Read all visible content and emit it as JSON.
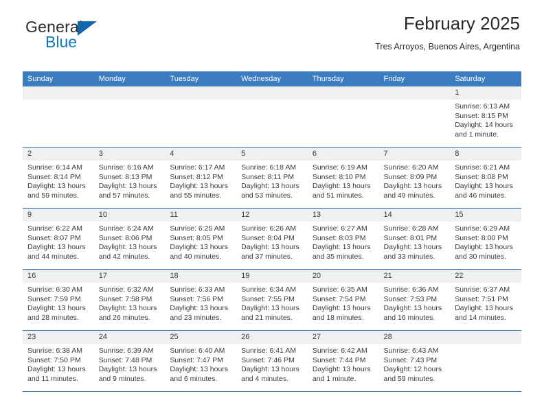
{
  "brand": {
    "line1": "General",
    "line2": "Blue",
    "triangle_icon": "blue-triangle-logo-mark",
    "color_dark": "#2b2b2b",
    "color_blue": "#1278bd"
  },
  "header": {
    "title": "February 2025",
    "subtitle": "Tres Arroyos, Buenos Aires, Argentina"
  },
  "theme": {
    "header_row_bg": "#3b7dc0",
    "daynum_band_bg": "#f0f0f0",
    "row_divider": "#3b7dc0",
    "text": "#3a3a3a"
  },
  "weekday_headers": [
    "Sunday",
    "Monday",
    "Tuesday",
    "Wednesday",
    "Thursday",
    "Friday",
    "Saturday"
  ],
  "weeks": [
    [
      {
        "day": "",
        "empty": true
      },
      {
        "day": "",
        "empty": true
      },
      {
        "day": "",
        "empty": true
      },
      {
        "day": "",
        "empty": true
      },
      {
        "day": "",
        "empty": true
      },
      {
        "day": "",
        "empty": true
      },
      {
        "day": "1",
        "sunrise": "Sunrise: 6:13 AM",
        "sunset": "Sunset: 8:15 PM",
        "daylight1": "Daylight: 14 hours",
        "daylight2": "and 1 minute."
      }
    ],
    [
      {
        "day": "2",
        "sunrise": "Sunrise: 6:14 AM",
        "sunset": "Sunset: 8:14 PM",
        "daylight1": "Daylight: 13 hours",
        "daylight2": "and 59 minutes."
      },
      {
        "day": "3",
        "sunrise": "Sunrise: 6:16 AM",
        "sunset": "Sunset: 8:13 PM",
        "daylight1": "Daylight: 13 hours",
        "daylight2": "and 57 minutes."
      },
      {
        "day": "4",
        "sunrise": "Sunrise: 6:17 AM",
        "sunset": "Sunset: 8:12 PM",
        "daylight1": "Daylight: 13 hours",
        "daylight2": "and 55 minutes."
      },
      {
        "day": "5",
        "sunrise": "Sunrise: 6:18 AM",
        "sunset": "Sunset: 8:11 PM",
        "daylight1": "Daylight: 13 hours",
        "daylight2": "and 53 minutes."
      },
      {
        "day": "6",
        "sunrise": "Sunrise: 6:19 AM",
        "sunset": "Sunset: 8:10 PM",
        "daylight1": "Daylight: 13 hours",
        "daylight2": "and 51 minutes."
      },
      {
        "day": "7",
        "sunrise": "Sunrise: 6:20 AM",
        "sunset": "Sunset: 8:09 PM",
        "daylight1": "Daylight: 13 hours",
        "daylight2": "and 49 minutes."
      },
      {
        "day": "8",
        "sunrise": "Sunrise: 6:21 AM",
        "sunset": "Sunset: 8:08 PM",
        "daylight1": "Daylight: 13 hours",
        "daylight2": "and 46 minutes."
      }
    ],
    [
      {
        "day": "9",
        "sunrise": "Sunrise: 6:22 AM",
        "sunset": "Sunset: 8:07 PM",
        "daylight1": "Daylight: 13 hours",
        "daylight2": "and 44 minutes."
      },
      {
        "day": "10",
        "sunrise": "Sunrise: 6:24 AM",
        "sunset": "Sunset: 8:06 PM",
        "daylight1": "Daylight: 13 hours",
        "daylight2": "and 42 minutes."
      },
      {
        "day": "11",
        "sunrise": "Sunrise: 6:25 AM",
        "sunset": "Sunset: 8:05 PM",
        "daylight1": "Daylight: 13 hours",
        "daylight2": "and 40 minutes."
      },
      {
        "day": "12",
        "sunrise": "Sunrise: 6:26 AM",
        "sunset": "Sunset: 8:04 PM",
        "daylight1": "Daylight: 13 hours",
        "daylight2": "and 37 minutes."
      },
      {
        "day": "13",
        "sunrise": "Sunrise: 6:27 AM",
        "sunset": "Sunset: 8:03 PM",
        "daylight1": "Daylight: 13 hours",
        "daylight2": "and 35 minutes."
      },
      {
        "day": "14",
        "sunrise": "Sunrise: 6:28 AM",
        "sunset": "Sunset: 8:01 PM",
        "daylight1": "Daylight: 13 hours",
        "daylight2": "and 33 minutes."
      },
      {
        "day": "15",
        "sunrise": "Sunrise: 6:29 AM",
        "sunset": "Sunset: 8:00 PM",
        "daylight1": "Daylight: 13 hours",
        "daylight2": "and 30 minutes."
      }
    ],
    [
      {
        "day": "16",
        "sunrise": "Sunrise: 6:30 AM",
        "sunset": "Sunset: 7:59 PM",
        "daylight1": "Daylight: 13 hours",
        "daylight2": "and 28 minutes."
      },
      {
        "day": "17",
        "sunrise": "Sunrise: 6:32 AM",
        "sunset": "Sunset: 7:58 PM",
        "daylight1": "Daylight: 13 hours",
        "daylight2": "and 26 minutes."
      },
      {
        "day": "18",
        "sunrise": "Sunrise: 6:33 AM",
        "sunset": "Sunset: 7:56 PM",
        "daylight1": "Daylight: 13 hours",
        "daylight2": "and 23 minutes."
      },
      {
        "day": "19",
        "sunrise": "Sunrise: 6:34 AM",
        "sunset": "Sunset: 7:55 PM",
        "daylight1": "Daylight: 13 hours",
        "daylight2": "and 21 minutes."
      },
      {
        "day": "20",
        "sunrise": "Sunrise: 6:35 AM",
        "sunset": "Sunset: 7:54 PM",
        "daylight1": "Daylight: 13 hours",
        "daylight2": "and 18 minutes."
      },
      {
        "day": "21",
        "sunrise": "Sunrise: 6:36 AM",
        "sunset": "Sunset: 7:53 PM",
        "daylight1": "Daylight: 13 hours",
        "daylight2": "and 16 minutes."
      },
      {
        "day": "22",
        "sunrise": "Sunrise: 6:37 AM",
        "sunset": "Sunset: 7:51 PM",
        "daylight1": "Daylight: 13 hours",
        "daylight2": "and 14 minutes."
      }
    ],
    [
      {
        "day": "23",
        "sunrise": "Sunrise: 6:38 AM",
        "sunset": "Sunset: 7:50 PM",
        "daylight1": "Daylight: 13 hours",
        "daylight2": "and 11 minutes."
      },
      {
        "day": "24",
        "sunrise": "Sunrise: 6:39 AM",
        "sunset": "Sunset: 7:48 PM",
        "daylight1": "Daylight: 13 hours",
        "daylight2": "and 9 minutes."
      },
      {
        "day": "25",
        "sunrise": "Sunrise: 6:40 AM",
        "sunset": "Sunset: 7:47 PM",
        "daylight1": "Daylight: 13 hours",
        "daylight2": "and 6 minutes."
      },
      {
        "day": "26",
        "sunrise": "Sunrise: 6:41 AM",
        "sunset": "Sunset: 7:46 PM",
        "daylight1": "Daylight: 13 hours",
        "daylight2": "and 4 minutes."
      },
      {
        "day": "27",
        "sunrise": "Sunrise: 6:42 AM",
        "sunset": "Sunset: 7:44 PM",
        "daylight1": "Daylight: 13 hours",
        "daylight2": "and 1 minute."
      },
      {
        "day": "28",
        "sunrise": "Sunrise: 6:43 AM",
        "sunset": "Sunset: 7:43 PM",
        "daylight1": "Daylight: 12 hours",
        "daylight2": "and 59 minutes."
      },
      {
        "day": "",
        "empty": true
      }
    ]
  ]
}
